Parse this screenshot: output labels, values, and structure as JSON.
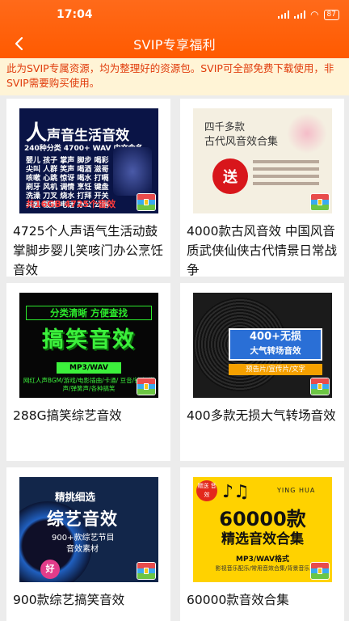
{
  "status_bar": {
    "time": "17:04",
    "battery": "87"
  },
  "app_bar": {
    "title": "SVIP专享福利"
  },
  "notice": {
    "text": "此为SVIP专属资源，均为整理好的资源包。SVIP可全部免费下载使用，非SVIP需要购买使用。"
  },
  "colors": {
    "accent": "#ff5a00",
    "notice_bg": "#fff4d6",
    "notice_text": "#e03a0a"
  },
  "items": [
    {
      "title": "4725个人声语气生活动鼓掌脚步婴儿笑咳门办公烹饪音效",
      "thumb": {
        "heading_big": "人",
        "heading_rest": "声音生活音效",
        "sub": "240种分类 4700+ WAV 中文命名",
        "words": "婴儿 孩子 掌声 脚步 喝彩 尖叫 人群 笑声 喝酒 滋哥 咳嗽 心跳 惊讶 喝水 打嗝 刷牙 风机 调情 烹饪 键盘 洗澡 刀叉 烧水 打拜 开关 斗殴 锻炼 电话 办公 公厕",
        "footer": "共16GB 4725个音效"
      }
    },
    {
      "title": "4000款古风音效 中国风音质武侠仙侠古代情景日常战争",
      "thumb": {
        "line1": "四千多款",
        "line2": "古代风音效合集",
        "stamp": "送"
      }
    },
    {
      "title": "288G搞笑综艺音效",
      "thumb": {
        "badge": "分类清晰 方便查找",
        "big": "搞笑音效",
        "format": "MP3/WAV",
        "desc": "网红人声BGM/游戏/电影插曲/卡通/ 豆音/铃声/掌声/弹簧声/各种搞笑"
      }
    },
    {
      "title": "400多款无损大气转场音效",
      "thumb": {
        "line1": "400+无损",
        "line2": "大气转场音效",
        "tag": "预告片/宣传片/文字"
      }
    },
    {
      "title": "900款综艺搞笑音效",
      "thumb": {
        "line1": "精挑细选",
        "line2": "综艺音效",
        "line3": "900+款综艺节目",
        "line4": "音效素材",
        "badge": "好"
      }
    },
    {
      "title": "60000款音效合集",
      "thumb": {
        "notes": "♪♫",
        "brand": "YING HUA",
        "big": "60000款",
        "mid": "精选音效合集",
        "format": "MP3/WAV格式",
        "footer": "影视音乐配乐/常用音效合集/背景音乐",
        "seal": "赠送 音效"
      }
    }
  ]
}
